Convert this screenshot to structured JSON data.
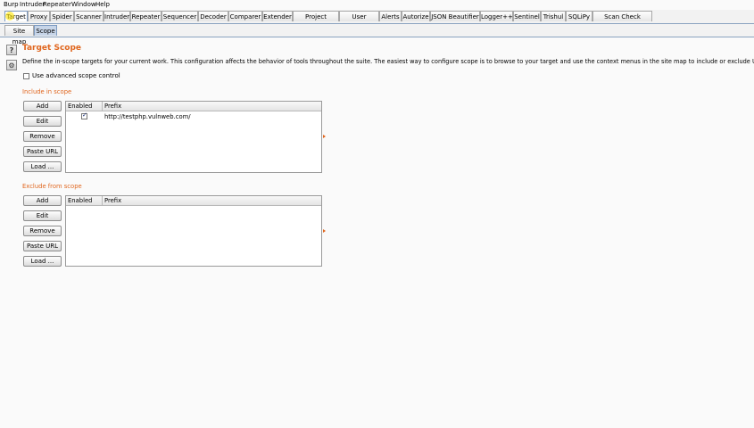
{
  "menu": [
    "Burp",
    "Intruder",
    "Repeater",
    "Window",
    "Help"
  ],
  "tabs": [
    "Target",
    "Proxy",
    "Spider",
    "Scanner",
    "Intruder",
    "Repeater",
    "Sequencer",
    "Decoder",
    "Comparer",
    "Extender",
    "Project options",
    "User options",
    "Alerts",
    "Autorize",
    "JSON Beautifier",
    "Logger++",
    "Sentinel",
    "Trishul",
    "SQLiPy",
    "Scan Check Builder"
  ],
  "subtabs": [
    "Site map",
    "Scope"
  ],
  "page": {
    "title": "Target Scope",
    "description": "Define the in-scope targets for your current work. This configuration affects the behavior of tools throughout the suite. The easiest way to configure scope is to browse to your target and use the context menus in the site map to include or exclude URL paths.",
    "advanced_label": "Use advanced scope control",
    "help_icon": "help-icon",
    "settings_icon": "gear-icon"
  },
  "include": {
    "label": "Include in scope",
    "buttons": [
      "Add",
      "Edit",
      "Remove",
      "Paste URL",
      "Load ..."
    ],
    "columns": [
      "Enabled",
      "Prefix"
    ],
    "rows": [
      {
        "enabled": true,
        "prefix": "http://testphp.vulnweb.com/"
      }
    ]
  },
  "exclude": {
    "label": "Exclude from scope",
    "buttons": [
      "Add",
      "Edit",
      "Remove",
      "Paste URL",
      "Load ..."
    ],
    "columns": [
      "Enabled",
      "Prefix"
    ],
    "rows": []
  },
  "colors": {
    "accent": "#e0661e",
    "tab_border": "#8aa3c0"
  }
}
